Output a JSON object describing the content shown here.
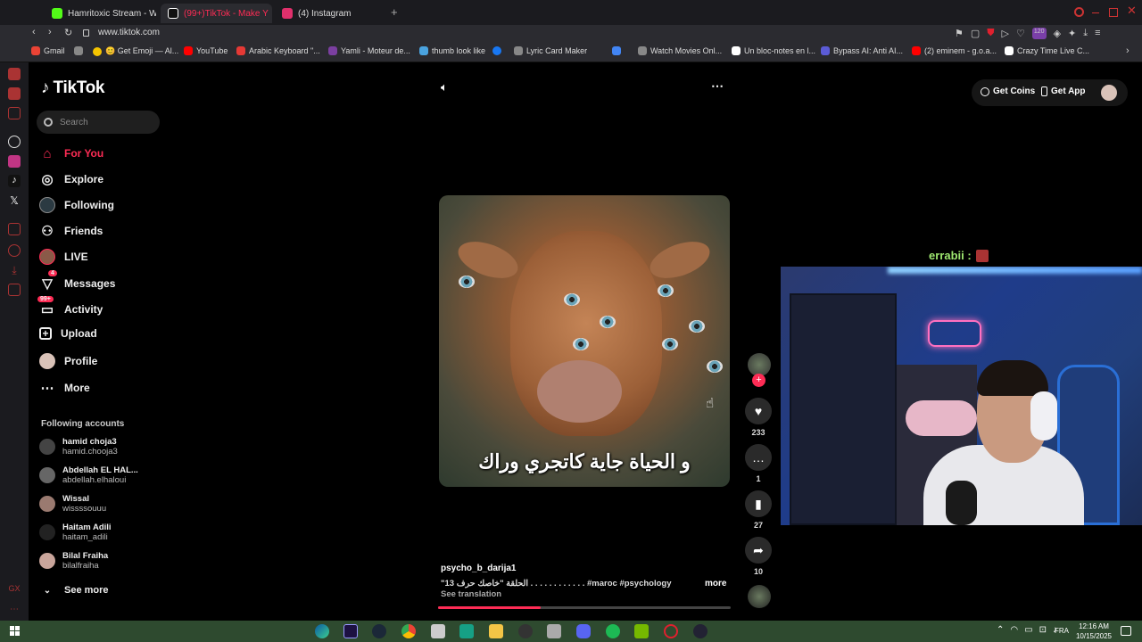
{
  "browser": {
    "tabs": [
      {
        "title": "Hamritoxic Stream - Watc",
        "color": "#53fc18"
      },
      {
        "title": "(99+)TikTok - Make Y",
        "color": "#ff2c55",
        "active": true
      },
      {
        "title": "(4) Instagram",
        "color": "#e1306c"
      }
    ],
    "new_tab_label": "+",
    "url": "www.tiktok.com",
    "bookmarks": [
      {
        "label": "Gmail",
        "color": "#ea4335"
      },
      {
        "label": "",
        "color": "#888"
      },
      {
        "label": "😊 Get Emoji — Al...",
        "color": "#f5c400"
      },
      {
        "label": "YouTube",
        "color": "#ff0000"
      },
      {
        "label": "Arabic Keyboard \"...",
        "color": "#e53935"
      },
      {
        "label": "Yamli - Moteur de...",
        "color": "#7b3fa0"
      },
      {
        "label": "thumb look like",
        "color": "#4aa3df"
      },
      {
        "label": "",
        "color": "#1877f2"
      },
      {
        "label": "Lyric Card Maker",
        "color": "#888"
      },
      {
        "label": "",
        "color": "#4285f4"
      },
      {
        "label": "Watch Movies Onl...",
        "color": "#888"
      },
      {
        "label": "Un bloc-notes en l...",
        "color": "#fff"
      },
      {
        "label": "Bypass AI: Anti AI...",
        "color": "#5b5bd6"
      },
      {
        "label": "(2) eminem - g.o.a...",
        "color": "#ff0000"
      },
      {
        "label": "Crazy Time Live C...",
        "color": "#fff"
      }
    ],
    "badge_count": "120"
  },
  "tiktok": {
    "logo": "TikTok",
    "search_placeholder": "Search",
    "nav": [
      {
        "label": "For You",
        "icon": "home-icon",
        "active": true
      },
      {
        "label": "Explore",
        "icon": "compass-icon"
      },
      {
        "label": "Following",
        "icon": "following-icon"
      },
      {
        "label": "Friends",
        "icon": "friends-icon"
      },
      {
        "label": "LIVE",
        "icon": "live-icon"
      },
      {
        "label": "Messages",
        "icon": "messages-icon",
        "badge": "4"
      },
      {
        "label": "Activity",
        "icon": "activity-icon",
        "badge": "99+"
      },
      {
        "label": "Upload",
        "icon": "upload-icon"
      },
      {
        "label": "Profile",
        "icon": "profile-icon"
      },
      {
        "label": "More",
        "icon": "more-icon"
      }
    ],
    "following_header": "Following accounts",
    "accounts": [
      {
        "name": "hamid choja3",
        "handle": "hamid.chooja3"
      },
      {
        "name": "Abdellah EL HAL...",
        "handle": "abdellah.elhaloui"
      },
      {
        "name": "Wissal",
        "handle": "wissssouuu"
      },
      {
        "name": "Haitam Adili",
        "handle": "haitam_adili"
      },
      {
        "name": "Bilal Fraiha",
        "handle": "bilalfraiha"
      }
    ],
    "see_more": "See more",
    "top_right": {
      "get_coins": "Get Coins",
      "get_app": "Get App"
    },
    "video": {
      "caption_overlay": "و الحياة جاية كاتجري وراك",
      "author": "psycho_b_darija1",
      "description": "\"13 الحلقة \"خاصك حرف . . . . . . . . . . . . #maroc  #psychology  ...",
      "more": "more",
      "see_translation": "See translation",
      "progress": 0.35
    },
    "actions": {
      "likes": "233",
      "comments": "1",
      "saves": "27",
      "shares": "10"
    }
  },
  "stream": {
    "username": "errabii :"
  },
  "taskbar": {
    "language": "FRA",
    "time": "12:16 AM",
    "date": "10/15/2025"
  },
  "colors": {
    "accent": "#fe2c55",
    "background": "#000000"
  }
}
